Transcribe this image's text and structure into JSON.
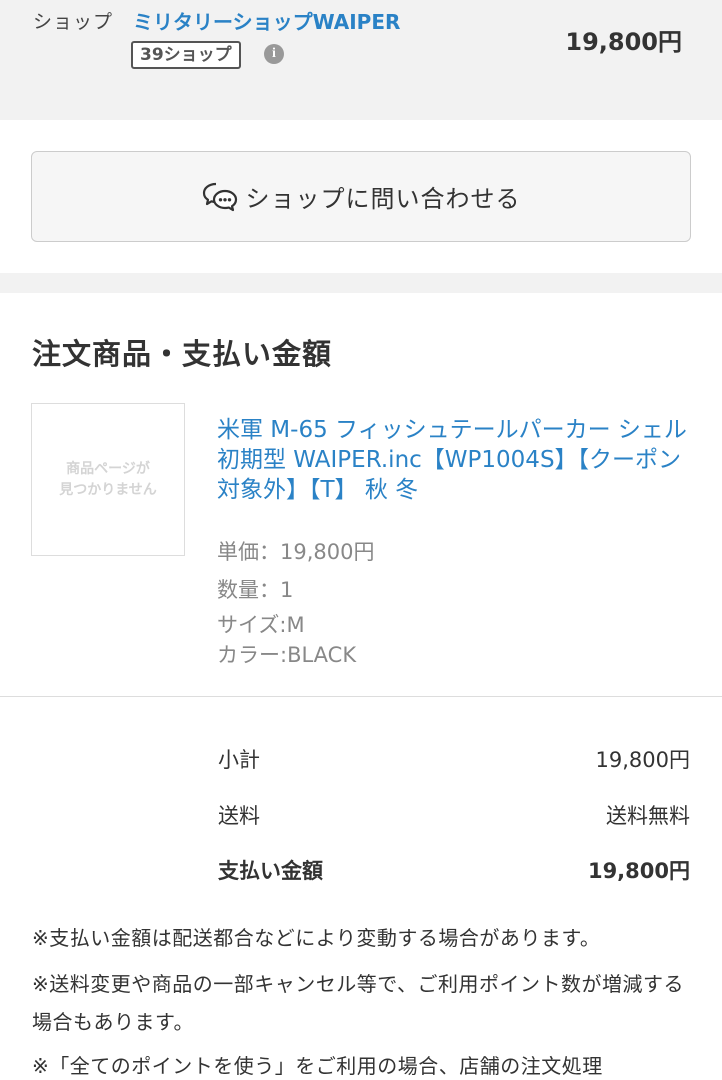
{
  "shop": {
    "label": "ショップ",
    "name": "ミリタリーショップWAIPER",
    "badge": "39ショップ",
    "info_icon": "i",
    "price": "19,800円"
  },
  "contact": {
    "button_label": "ショップに問い合わせる",
    "icon": "chat-bubbles-icon"
  },
  "order": {
    "title": "注文商品・支払い金額",
    "thumbnail_text": "商品ページが\n見つかりません",
    "product_name": "米軍 M-65 フィッシュテールパーカー シェル 初期型 WAIPER.inc【WP1004S】【クーポン対象外】【T】 秋 冬",
    "unit_price": "単価：19,800円",
    "quantity": "数量：1",
    "size": "サイズ:M",
    "color": "カラー:BLACK"
  },
  "summary": {
    "subtotal_label": "小計",
    "subtotal_value": "19,800円",
    "shipping_label": "送料",
    "shipping_value": "送料無料",
    "total_label": "支払い金額",
    "total_value": "19,800円"
  },
  "notes": [
    "※支払い金額は配送都合などにより変動する場合があります。",
    "※送料変更や商品の一部キャンセル等で、ご利用ポイント数が増減する場合もあります。",
    "※「全てのポイントを使う」をご利用の場合、店舗の注文処理"
  ],
  "colors": {
    "link": "#2a82c6",
    "background": "#f2f2f2"
  }
}
